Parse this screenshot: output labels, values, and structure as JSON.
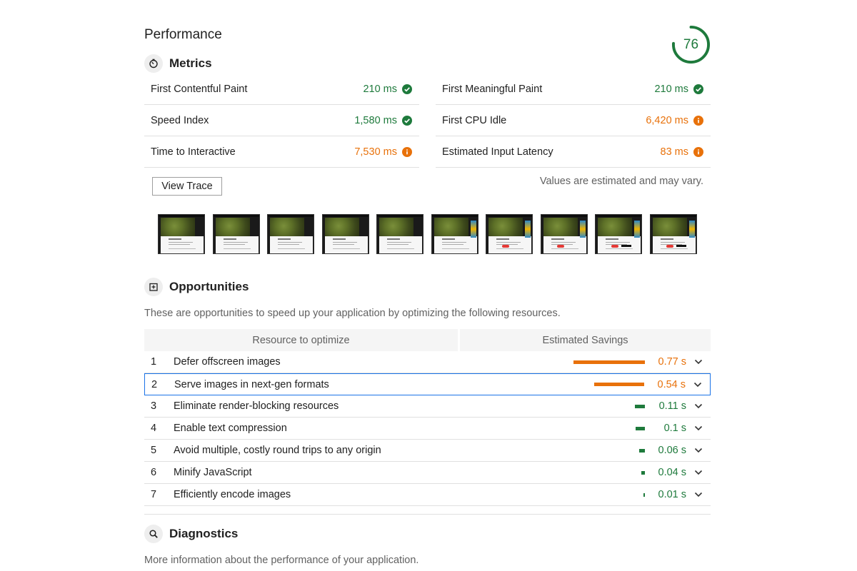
{
  "performance": {
    "title": "Performance",
    "score": "76",
    "score_fraction": 0.76,
    "score_color": "#1e7a3c"
  },
  "metrics": {
    "title": "Metrics",
    "icon": "stopwatch-icon",
    "items": [
      {
        "label": "First Contentful Paint",
        "value": "210 ms",
        "status": "pass"
      },
      {
        "label": "First Meaningful Paint",
        "value": "210 ms",
        "status": "pass"
      },
      {
        "label": "Speed Index",
        "value": "1,580 ms",
        "status": "pass"
      },
      {
        "label": "First CPU Idle",
        "value": "6,420 ms",
        "status": "average"
      },
      {
        "label": "Time to Interactive",
        "value": "7,530 ms",
        "status": "average"
      },
      {
        "label": "Estimated Input Latency",
        "value": "83 ms",
        "status": "average"
      }
    ],
    "view_trace_label": "View Trace",
    "estimate_note": "Values are estimated and may vary."
  },
  "opportunities": {
    "title": "Opportunities",
    "icon": "opportunity-icon",
    "description": "These are opportunities to speed up your application by optimizing the following resources.",
    "col_resource": "Resource to optimize",
    "col_savings": "Estimated Savings",
    "items": [
      {
        "num": "1",
        "label": "Defer offscreen images",
        "savings": "0.77 s",
        "seconds": 0.77,
        "status": "average"
      },
      {
        "num": "2",
        "label": "Serve images in next-gen formats",
        "savings": "0.54 s",
        "seconds": 0.54,
        "status": "average"
      },
      {
        "num": "3",
        "label": "Eliminate render-blocking resources",
        "savings": "0.11 s",
        "seconds": 0.11,
        "status": "pass"
      },
      {
        "num": "4",
        "label": "Enable text compression",
        "savings": "0.1 s",
        "seconds": 0.1,
        "status": "pass"
      },
      {
        "num": "5",
        "label": "Avoid multiple, costly round trips to any origin",
        "savings": "0.06 s",
        "seconds": 0.06,
        "status": "pass"
      },
      {
        "num": "6",
        "label": "Minify JavaScript",
        "savings": "0.04 s",
        "seconds": 0.04,
        "status": "pass"
      },
      {
        "num": "7",
        "label": "Efficiently encode images",
        "savings": "0.01 s",
        "seconds": 0.01,
        "status": "pass"
      }
    ]
  },
  "diagnostics": {
    "title": "Diagnostics",
    "icon": "search-icon",
    "description": "More information about the performance of your application."
  },
  "colors": {
    "pass": "#1e7a3c",
    "average": "#e8710a",
    "selected_border": "#1a73e8"
  }
}
